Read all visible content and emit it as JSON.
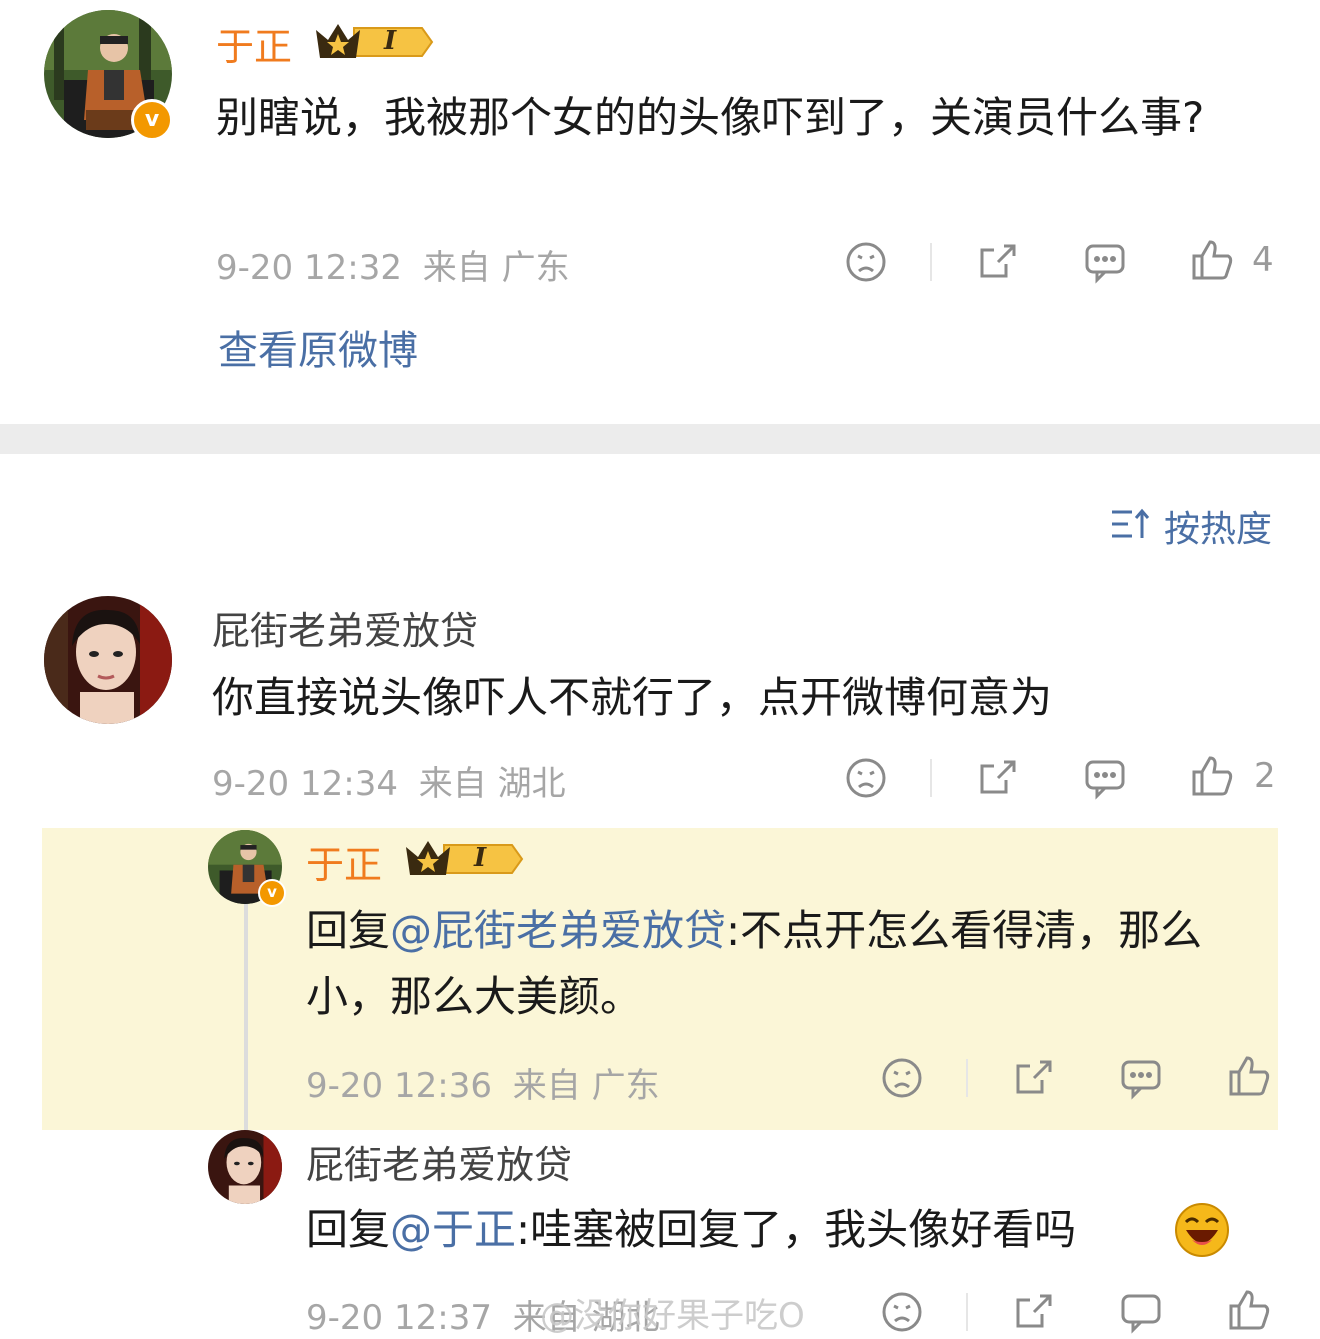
{
  "post": {
    "author": "于正",
    "level": "I",
    "text": "别瞎说，我被那个女的的头像吓到了，关演员什么事?",
    "time": "9-20 12:32",
    "source": "来自 广东",
    "likes": "4",
    "view_original": "查看原微博"
  },
  "sort": {
    "label": "按热度"
  },
  "comment": {
    "author": "屁街老弟爱放贷",
    "text": "你直接说头像吓人不就行了，点开微博何意为",
    "time": "9-20 12:34",
    "source": "来自 湖北",
    "likes": "2"
  },
  "reply1": {
    "author": "于正",
    "level": "I",
    "prefix": "回复",
    "mention": "@屁街老弟爱放贷",
    "text": ":不点开怎么看得清，那么小，那么大美颜。",
    "time": "9-20 12:36",
    "source": "来自 广东"
  },
  "reply2": {
    "author": "屁街老弟爱放贷",
    "prefix": "回复",
    "mention": "@于正",
    "text": ":哇塞被回复了，我头像好看吗",
    "time": "9-20 12:37",
    "source": "来自 湖北"
  },
  "watermark": "@没你好果子吃O",
  "colors": {
    "accent_orange": "#f07b1e",
    "link_blue": "#4a6fa5",
    "highlight_bg": "#fbf6d7",
    "verified_badge": "#f39800"
  },
  "icons": [
    "sad-face-icon",
    "share-icon",
    "comment-icon",
    "like-icon",
    "crown-icon",
    "sort-icon",
    "laughing-emoji-icon"
  ]
}
